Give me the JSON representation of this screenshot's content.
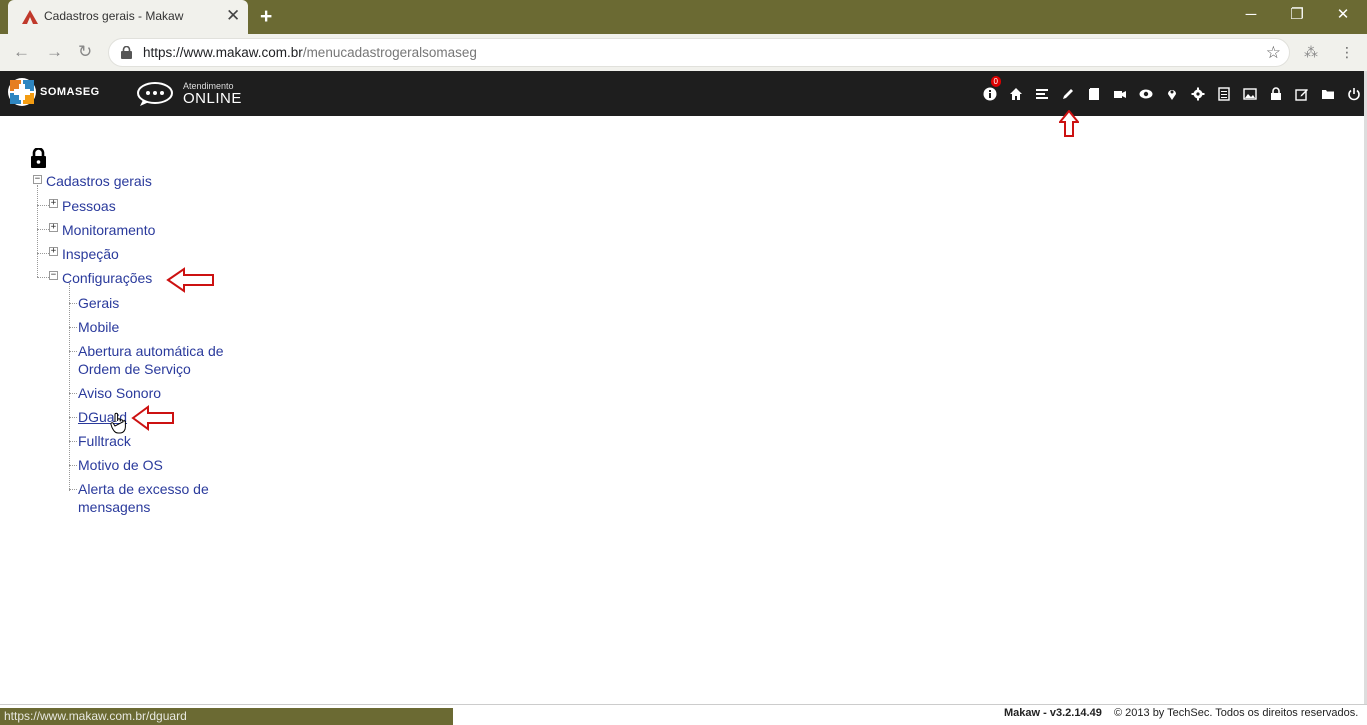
{
  "browser": {
    "tab_title": "Cadastros gerais - Makaw",
    "tab_close": "✕",
    "new_tab": "+",
    "url_host": "https://www.makaw.com.br",
    "url_path": "/menucadastrogeralsomaseg",
    "status_url": "https://www.makaw.com.br/dguard",
    "win_min": "─",
    "win_max": "❐",
    "win_close": "✕"
  },
  "header": {
    "logo_text": "SOMASEG",
    "atendimento_small": "Atendimento",
    "atendimento_big": "ONLINE",
    "notification_count": "0",
    "icons": [
      "info-icon",
      "home-icon",
      "list-icon",
      "pencil-icon",
      "book-icon",
      "video-icon",
      "eye-icon",
      "map-pin-icon",
      "gear-icon",
      "document-icon",
      "image-icon",
      "lock-icon",
      "edit-icon",
      "folder-icon",
      "power-icon"
    ]
  },
  "tree": {
    "root": "Cadastros gerais",
    "children": [
      {
        "label": "Pessoas",
        "expander": "+"
      },
      {
        "label": "Monitoramento",
        "expander": "+"
      },
      {
        "label": "Inspeção",
        "expander": "+"
      },
      {
        "label": "Configurações",
        "expander": "−"
      }
    ],
    "root_expander": "−",
    "config_items": [
      "Gerais",
      "Mobile",
      "Abertura automática de",
      "Ordem de Serviço",
      "Aviso Sonoro",
      "DGuard",
      "Fulltrack",
      "Motivo de OS",
      "Alerta de excesso de",
      "mensagens"
    ]
  },
  "footer": {
    "version": "Makaw - v3.2.14.49",
    "copyright": "© 2013 by TechSec. Todos os direitos reservados."
  },
  "colors": {
    "chrome": "#6b6a33",
    "header_bg": "#1e1e1e",
    "link": "#2a3a9c",
    "annotation_arrow": "#cc1111"
  }
}
